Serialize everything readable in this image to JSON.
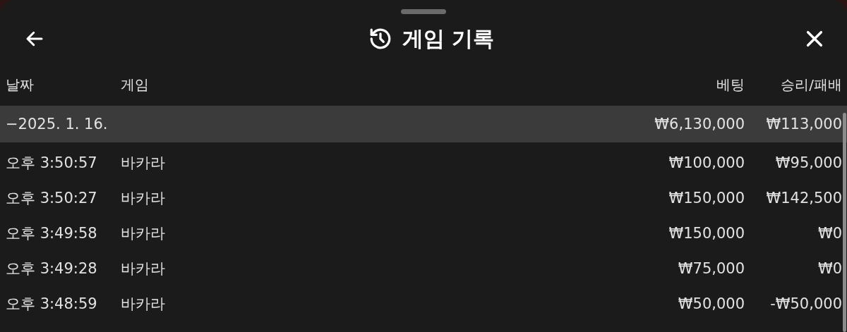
{
  "header": {
    "title": "게임 기록"
  },
  "table": {
    "columns": [
      "날짜",
      "게임",
      "베팅",
      "승리/패배"
    ],
    "group": {
      "label": "−2025. 1. 16.",
      "bet": "₩6,130,000",
      "result": "₩113,000",
      "selected": true
    },
    "rows": [
      {
        "time": "오후 3:50:57",
        "game": "바카라",
        "bet": "₩100,000",
        "result": "₩95,000"
      },
      {
        "time": "오후 3:50:27",
        "game": "바카라",
        "bet": "₩150,000",
        "result": "₩142,500"
      },
      {
        "time": "오후 3:49:58",
        "game": "바카라",
        "bet": "₩150,000",
        "result": "₩0"
      },
      {
        "time": "오후 3:49:28",
        "game": "바카라",
        "bet": "₩75,000",
        "result": "₩0"
      },
      {
        "time": "오후 3:48:59",
        "game": "바카라",
        "bet": "₩50,000",
        "result": "-₩50,000"
      }
    ]
  }
}
